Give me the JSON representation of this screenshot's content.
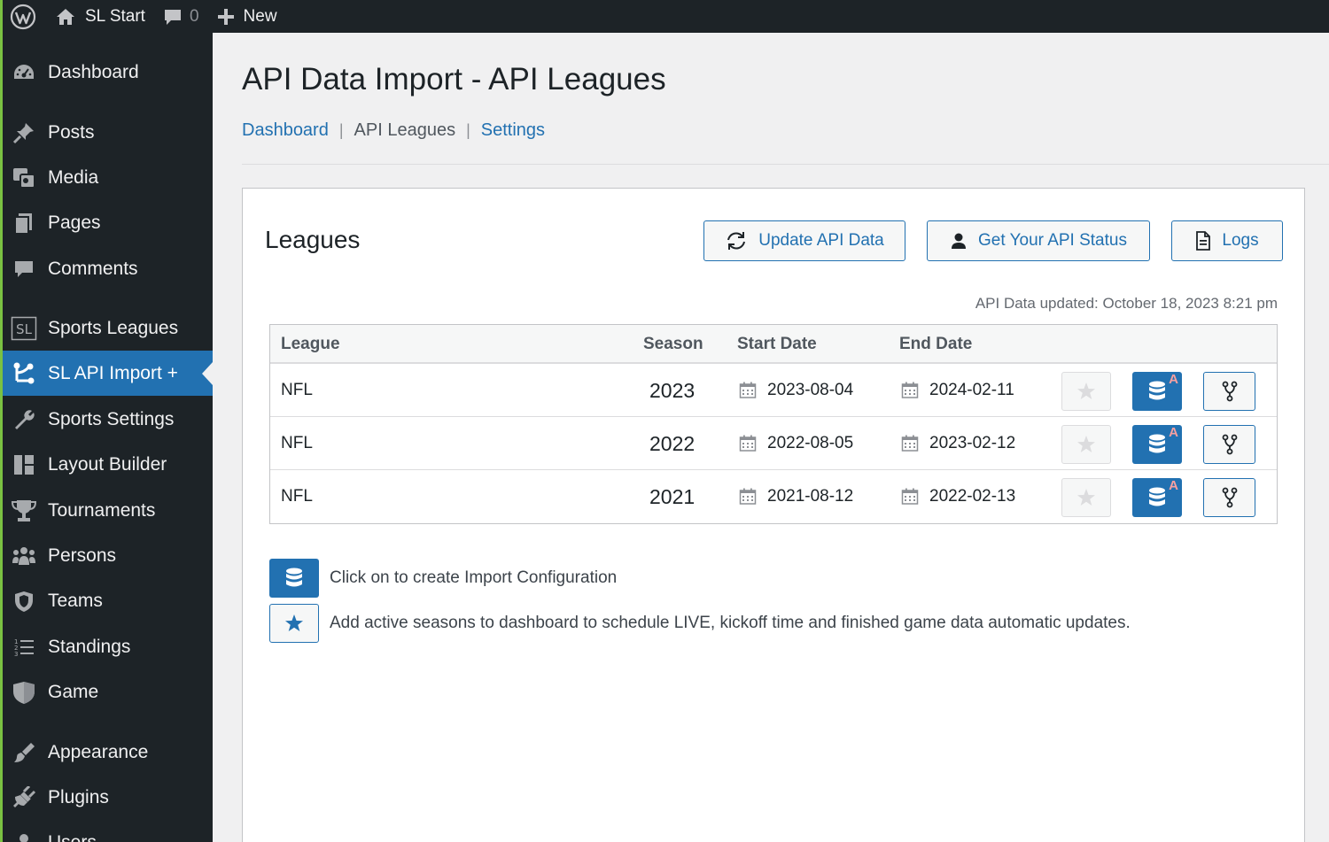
{
  "adminbar": {
    "site_name": "SL Start",
    "comments_count": "0",
    "new_label": "New"
  },
  "sidebar": {
    "items": [
      {
        "label": "Dashboard",
        "icon": "dashboard-icon"
      },
      {
        "label": "Posts",
        "icon": "pin-icon"
      },
      {
        "label": "Media",
        "icon": "media-icon"
      },
      {
        "label": "Pages",
        "icon": "pages-icon"
      },
      {
        "label": "Comments",
        "icon": "comment-icon"
      },
      {
        "label": "Sports Leagues",
        "icon": "sl-box-icon"
      },
      {
        "label": "SL API Import +",
        "icon": "network-icon",
        "current": true
      },
      {
        "label": "Sports Settings",
        "icon": "wrench-icon"
      },
      {
        "label": "Layout Builder",
        "icon": "layout-icon"
      },
      {
        "label": "Tournaments",
        "icon": "trophy-icon"
      },
      {
        "label": "Persons",
        "icon": "groups-icon"
      },
      {
        "label": "Teams",
        "icon": "shield-icon"
      },
      {
        "label": "Standings",
        "icon": "ordered-list-icon"
      },
      {
        "label": "Game",
        "icon": "shield-half-icon"
      },
      {
        "label": "Appearance",
        "icon": "brush-icon"
      },
      {
        "label": "Plugins",
        "icon": "plugin-icon"
      },
      {
        "label": "Users",
        "icon": "users-icon"
      }
    ]
  },
  "page": {
    "title": "API Data Import - API Leagues",
    "subnav": {
      "dashboard": "Dashboard",
      "leagues": "API Leagues",
      "settings": "Settings",
      "separator": "|"
    }
  },
  "panel": {
    "title": "Leagues",
    "update_button": "Update API Data",
    "status_button": "Get Your API Status",
    "logs_button": "Logs",
    "updated_text": "API Data updated: October 18, 2023 8:21 pm"
  },
  "table": {
    "columns": {
      "league": "League",
      "season": "Season",
      "start": "Start Date",
      "end": "End Date"
    },
    "rows": [
      {
        "league": "NFL",
        "season": "2023",
        "start": "2023-08-04",
        "end": "2024-02-11",
        "badge": "A"
      },
      {
        "league": "NFL",
        "season": "2022",
        "start": "2022-08-05",
        "end": "2023-02-12",
        "badge": "A"
      },
      {
        "league": "NFL",
        "season": "2021",
        "start": "2021-08-12",
        "end": "2022-02-13",
        "badge": "A"
      }
    ]
  },
  "legend": {
    "import_text": "Click on to create Import Configuration",
    "active_text": "Add active seasons to dashboard to schedule LIVE, kickoff time and finished game data automatic updates."
  },
  "colors": {
    "primary": "#2271b1",
    "adminbar": "#1d2327",
    "accent_stripe": "#7ac142"
  }
}
